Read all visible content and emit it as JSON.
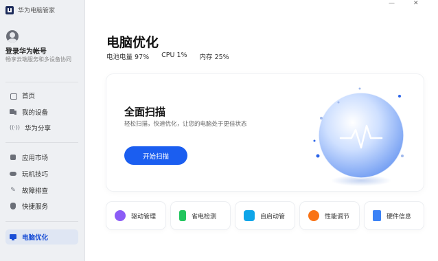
{
  "app": {
    "title": "华为电脑管家"
  },
  "window": {
    "minimize": "—",
    "close": "✕"
  },
  "account": {
    "title": "登录华为帐号",
    "subtitle": "畅享云端服务和多设备协同"
  },
  "nav": {
    "group1": [
      {
        "label": "首页",
        "icon": "home-icon"
      },
      {
        "label": "我的设备",
        "icon": "devices-icon"
      },
      {
        "label": "华为分享",
        "icon": "share-icon"
      }
    ],
    "group2": [
      {
        "label": "应用市场",
        "icon": "app-store-icon"
      },
      {
        "label": "玩机技巧",
        "icon": "tips-icon"
      },
      {
        "label": "故障排查",
        "icon": "wrench-icon"
      },
      {
        "label": "快捷服务",
        "icon": "service-icon"
      }
    ],
    "active": {
      "label": "电脑优化",
      "icon": "monitor-icon"
    }
  },
  "main": {
    "title": "电脑优化",
    "status": {
      "battery": "电池电量 97%",
      "cpu": "CPU 1%",
      "memory": "内存 25%"
    },
    "scan": {
      "title": "全面扫描",
      "description": "轻松扫描，快速优化，让您的电脑处于更佳状态",
      "button": "开始扫描"
    },
    "tools": [
      {
        "label": "驱动管理",
        "icon": "driver-icon",
        "color": "#8b5cf6"
      },
      {
        "label": "省电检测",
        "icon": "battery-icon",
        "color": "#22c55e"
      },
      {
        "label": "自启动管",
        "icon": "startup-icon",
        "color": "#0ea5e9"
      },
      {
        "label": "性能调节",
        "icon": "gauge-icon",
        "color": "#f97316"
      },
      {
        "label": "硬件信息",
        "icon": "document-icon",
        "color": "#3b82f6"
      }
    ]
  },
  "colors": {
    "accent": "#1b5ef0",
    "sidebar": "#eef0f3",
    "active_bg": "#dfe6f3"
  }
}
